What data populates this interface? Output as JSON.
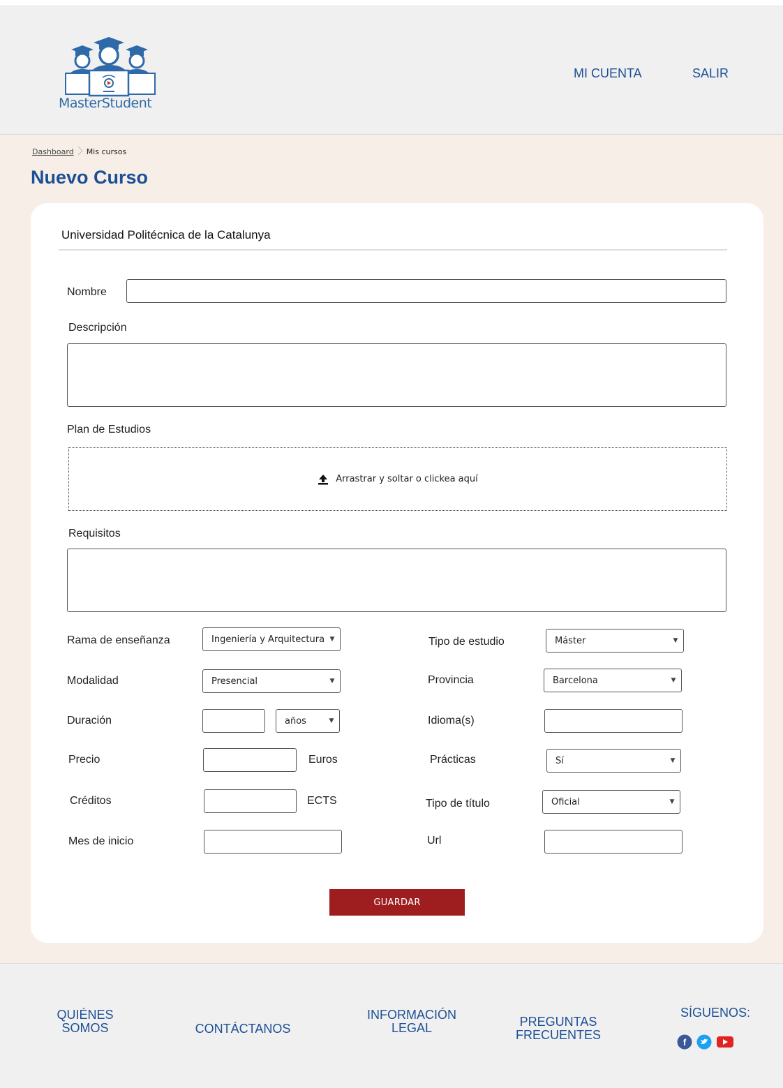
{
  "header": {
    "logo_text": "MasterStudent",
    "nav": {
      "account": "MI CUENTA",
      "logout": "SALIR"
    }
  },
  "breadcrumb": {
    "home": "Dashboard",
    "current": "Mis cursos"
  },
  "page_title": "Nuevo Curso",
  "form": {
    "university": "Universidad Politécnica de la Catalunya",
    "nombre_label": "Nombre",
    "nombre_value": "",
    "descripcion_label": "Descripción",
    "plan_label": "Plan de Estudios",
    "dropzone_text": "Arrastrar y soltar o clickea aquí",
    "requisitos_label": "Requisitos",
    "rama_label": "Rama de enseñanza",
    "rama_value": "Ingeniería y Arquitectura",
    "modalidad_label": "Modalidad",
    "modalidad_value": "Presencial",
    "duracion_label": "Duración",
    "duracion_unit": "años",
    "precio_label": "Precio",
    "precio_unit": "Euros",
    "creditos_label": "Créditos",
    "creditos_unit": "ECTS",
    "mes_label": "Mes de inicio",
    "tipo_estudio_label": "Tipo de estudio",
    "tipo_estudio_value": "Máster",
    "provincia_label": "Provincia",
    "provincia_value": "Barcelona",
    "idioma_label": "Idioma(s)",
    "practicas_label": "Prácticas",
    "practicas_value": "Sí",
    "tipo_titulo_label": "Tipo de título",
    "tipo_titulo_value": "Oficial",
    "url_label": "Url",
    "save_label": "GUARDAR"
  },
  "footer": {
    "about_l1": "QUIÉNES",
    "about_l2": "SOMOS",
    "contact": "CONTÁCTANOS",
    "legal_l1": "INFORMACIÓN",
    "legal_l2": "LEGAL",
    "faq_l1": "PREGUNTAS",
    "faq_l2": "FRECUENTES",
    "follow": "SÍGUENOS:"
  },
  "colors": {
    "brand_blue": "#1c4f96",
    "save_red": "#9e1e20",
    "content_bg": "#f7efe7",
    "facebook": "#3b5998",
    "twitter": "#1da1f2",
    "youtube": "#e02424"
  },
  "icons": [
    "graduates-logo-icon",
    "upload-icon",
    "chevron-down-icon",
    "facebook-icon",
    "twitter-icon",
    "youtube-icon"
  ]
}
